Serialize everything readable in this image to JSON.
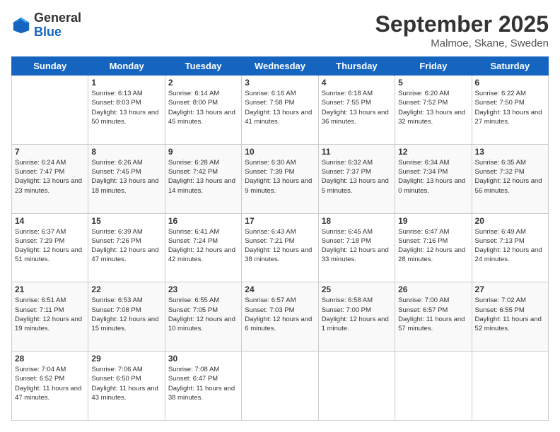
{
  "header": {
    "logo": {
      "general": "General",
      "blue": "Blue"
    },
    "title": "September 2025",
    "location": "Malmoe, Skane, Sweden"
  },
  "days_of_week": [
    "Sunday",
    "Monday",
    "Tuesday",
    "Wednesday",
    "Thursday",
    "Friday",
    "Saturday"
  ],
  "weeks": [
    [
      {
        "day": "",
        "sunrise": "",
        "sunset": "",
        "daylight": ""
      },
      {
        "day": "1",
        "sunrise": "Sunrise: 6:13 AM",
        "sunset": "Sunset: 8:03 PM",
        "daylight": "Daylight: 13 hours and 50 minutes."
      },
      {
        "day": "2",
        "sunrise": "Sunrise: 6:14 AM",
        "sunset": "Sunset: 8:00 PM",
        "daylight": "Daylight: 13 hours and 45 minutes."
      },
      {
        "day": "3",
        "sunrise": "Sunrise: 6:16 AM",
        "sunset": "Sunset: 7:58 PM",
        "daylight": "Daylight: 13 hours and 41 minutes."
      },
      {
        "day": "4",
        "sunrise": "Sunrise: 6:18 AM",
        "sunset": "Sunset: 7:55 PM",
        "daylight": "Daylight: 13 hours and 36 minutes."
      },
      {
        "day": "5",
        "sunrise": "Sunrise: 6:20 AM",
        "sunset": "Sunset: 7:52 PM",
        "daylight": "Daylight: 13 hours and 32 minutes."
      },
      {
        "day": "6",
        "sunrise": "Sunrise: 6:22 AM",
        "sunset": "Sunset: 7:50 PM",
        "daylight": "Daylight: 13 hours and 27 minutes."
      }
    ],
    [
      {
        "day": "7",
        "sunrise": "Sunrise: 6:24 AM",
        "sunset": "Sunset: 7:47 PM",
        "daylight": "Daylight: 13 hours and 23 minutes."
      },
      {
        "day": "8",
        "sunrise": "Sunrise: 6:26 AM",
        "sunset": "Sunset: 7:45 PM",
        "daylight": "Daylight: 13 hours and 18 minutes."
      },
      {
        "day": "9",
        "sunrise": "Sunrise: 6:28 AM",
        "sunset": "Sunset: 7:42 PM",
        "daylight": "Daylight: 13 hours and 14 minutes."
      },
      {
        "day": "10",
        "sunrise": "Sunrise: 6:30 AM",
        "sunset": "Sunset: 7:39 PM",
        "daylight": "Daylight: 13 hours and 9 minutes."
      },
      {
        "day": "11",
        "sunrise": "Sunrise: 6:32 AM",
        "sunset": "Sunset: 7:37 PM",
        "daylight": "Daylight: 13 hours and 5 minutes."
      },
      {
        "day": "12",
        "sunrise": "Sunrise: 6:34 AM",
        "sunset": "Sunset: 7:34 PM",
        "daylight": "Daylight: 13 hours and 0 minutes."
      },
      {
        "day": "13",
        "sunrise": "Sunrise: 6:35 AM",
        "sunset": "Sunset: 7:32 PM",
        "daylight": "Daylight: 12 hours and 56 minutes."
      }
    ],
    [
      {
        "day": "14",
        "sunrise": "Sunrise: 6:37 AM",
        "sunset": "Sunset: 7:29 PM",
        "daylight": "Daylight: 12 hours and 51 minutes."
      },
      {
        "day": "15",
        "sunrise": "Sunrise: 6:39 AM",
        "sunset": "Sunset: 7:26 PM",
        "daylight": "Daylight: 12 hours and 47 minutes."
      },
      {
        "day": "16",
        "sunrise": "Sunrise: 6:41 AM",
        "sunset": "Sunset: 7:24 PM",
        "daylight": "Daylight: 12 hours and 42 minutes."
      },
      {
        "day": "17",
        "sunrise": "Sunrise: 6:43 AM",
        "sunset": "Sunset: 7:21 PM",
        "daylight": "Daylight: 12 hours and 38 minutes."
      },
      {
        "day": "18",
        "sunrise": "Sunrise: 6:45 AM",
        "sunset": "Sunset: 7:18 PM",
        "daylight": "Daylight: 12 hours and 33 minutes."
      },
      {
        "day": "19",
        "sunrise": "Sunrise: 6:47 AM",
        "sunset": "Sunset: 7:16 PM",
        "daylight": "Daylight: 12 hours and 28 minutes."
      },
      {
        "day": "20",
        "sunrise": "Sunrise: 6:49 AM",
        "sunset": "Sunset: 7:13 PM",
        "daylight": "Daylight: 12 hours and 24 minutes."
      }
    ],
    [
      {
        "day": "21",
        "sunrise": "Sunrise: 6:51 AM",
        "sunset": "Sunset: 7:11 PM",
        "daylight": "Daylight: 12 hours and 19 minutes."
      },
      {
        "day": "22",
        "sunrise": "Sunrise: 6:53 AM",
        "sunset": "Sunset: 7:08 PM",
        "daylight": "Daylight: 12 hours and 15 minutes."
      },
      {
        "day": "23",
        "sunrise": "Sunrise: 6:55 AM",
        "sunset": "Sunset: 7:05 PM",
        "daylight": "Daylight: 12 hours and 10 minutes."
      },
      {
        "day": "24",
        "sunrise": "Sunrise: 6:57 AM",
        "sunset": "Sunset: 7:03 PM",
        "daylight": "Daylight: 12 hours and 6 minutes."
      },
      {
        "day": "25",
        "sunrise": "Sunrise: 6:58 AM",
        "sunset": "Sunset: 7:00 PM",
        "daylight": "Daylight: 12 hours and 1 minute."
      },
      {
        "day": "26",
        "sunrise": "Sunrise: 7:00 AM",
        "sunset": "Sunset: 6:57 PM",
        "daylight": "Daylight: 11 hours and 57 minutes."
      },
      {
        "day": "27",
        "sunrise": "Sunrise: 7:02 AM",
        "sunset": "Sunset: 6:55 PM",
        "daylight": "Daylight: 11 hours and 52 minutes."
      }
    ],
    [
      {
        "day": "28",
        "sunrise": "Sunrise: 7:04 AM",
        "sunset": "Sunset: 6:52 PM",
        "daylight": "Daylight: 11 hours and 47 minutes."
      },
      {
        "day": "29",
        "sunrise": "Sunrise: 7:06 AM",
        "sunset": "Sunset: 6:50 PM",
        "daylight": "Daylight: 11 hours and 43 minutes."
      },
      {
        "day": "30",
        "sunrise": "Sunrise: 7:08 AM",
        "sunset": "Sunset: 6:47 PM",
        "daylight": "Daylight: 11 hours and 38 minutes."
      },
      {
        "day": "",
        "sunrise": "",
        "sunset": "",
        "daylight": ""
      },
      {
        "day": "",
        "sunrise": "",
        "sunset": "",
        "daylight": ""
      },
      {
        "day": "",
        "sunrise": "",
        "sunset": "",
        "daylight": ""
      },
      {
        "day": "",
        "sunrise": "",
        "sunset": "",
        "daylight": ""
      }
    ]
  ]
}
